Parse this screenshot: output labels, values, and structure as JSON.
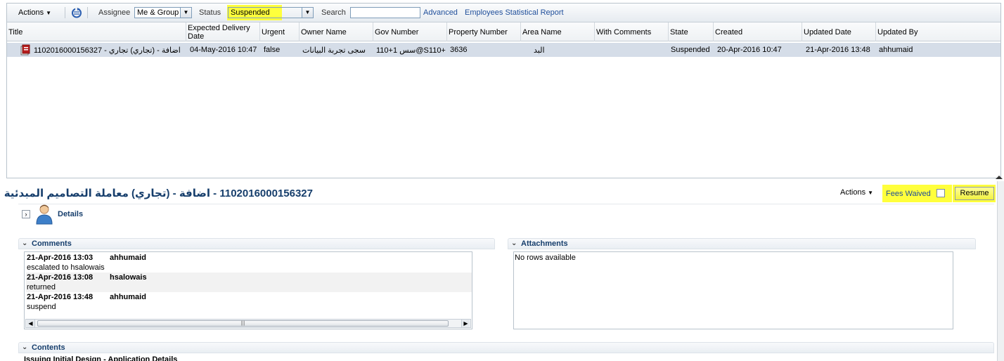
{
  "toolbar": {
    "actions_label": "Actions",
    "assignee_label": "Assignee",
    "assignee_value": "Me & Group",
    "status_label": "Status",
    "status_value": "Suspended",
    "search_label": "Search",
    "search_value": "",
    "advanced_link": "Advanced",
    "report_link": "Employees Statistical Report",
    "highlight_color": "#ffff3c"
  },
  "grid": {
    "columns": [
      "Title",
      "Expected Delivery Date",
      "Urgent",
      "Owner Name",
      "Gov Number",
      "Property Number",
      "Area Name",
      "With Comments",
      "State",
      "Created",
      "Updated Date",
      "Updated By"
    ],
    "rows": [
      {
        "title": "1102016000156327 - اضافة - (تجاري) تجاري",
        "expected_delivery": "04-May-2016 10:47",
        "urgent": "false",
        "owner_name": "سجى تجربة البيانات",
        "gov_number": "110+1 سس@S110+",
        "property_number": "3636",
        "area_name": "البد",
        "with_comments": "",
        "state": "Suspended",
        "created": "20-Apr-2016 10:47",
        "updated_date": "21-Apr-2016 13:48",
        "updated_by": "ahhumaid"
      }
    ]
  },
  "detail": {
    "title": "1102016000156327 - اضافة - (تجاري) معاملة التصاميم المبدئية",
    "actions_label": "Actions",
    "fees_waived_label": "Fees Waived",
    "resume_label": "Resume",
    "details_label": "Details",
    "comments_label": "Comments",
    "attachments_label": "Attachments",
    "no_rows": "No rows available",
    "contents_label": "Contents",
    "contents_subtitle": "Issuing Initial Design - Application Details",
    "comments": [
      {
        "date": "21-Apr-2016 13:03",
        "user": "ahhumaid",
        "text": "escalated to hsalowais"
      },
      {
        "date": "21-Apr-2016 13:08",
        "user": "hsalowais",
        "text": "returned"
      },
      {
        "date": "21-Apr-2016 13:48",
        "user": "ahhumaid",
        "text": "suspend"
      }
    ]
  }
}
